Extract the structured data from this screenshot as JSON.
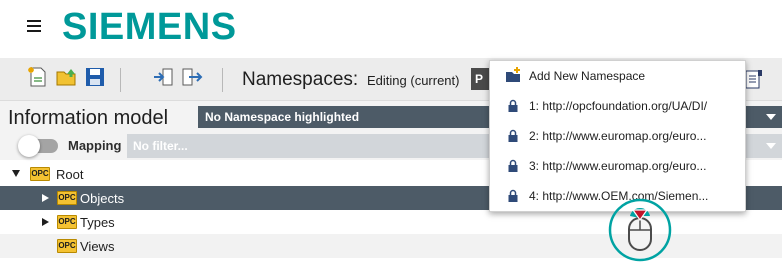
{
  "header": {
    "logo_text": "SIEMENS",
    "logo_color": "#009999"
  },
  "toolbar": {
    "namespaces_label": "Namespaces:",
    "editing_text": "Editing (current)",
    "namespace_box_text": "P",
    "icons": [
      "new-file-icon",
      "open-folder-icon",
      "save-icon",
      "import-icon",
      "export-icon",
      "properties-icon"
    ]
  },
  "info_model": {
    "title": "Information model",
    "namespace_highlight": "No Namespace highlighted"
  },
  "mapping": {
    "label": "Mapping",
    "filter_placeholder": "No filter..."
  },
  "tree": {
    "root": "Root",
    "opc_badge": "OPC",
    "items": [
      {
        "label": "Objects",
        "selected": true
      },
      {
        "label": "Types",
        "selected": false
      },
      {
        "label": "Views",
        "selected": false
      }
    ]
  },
  "menu": {
    "add_label": "Add New Namespace",
    "items": [
      {
        "label": "1: http://opcfoundation.org/UA/DI/"
      },
      {
        "label": "2: http://www.euromap.org/euro..."
      },
      {
        "label": "3: http://www.euromap.org/euro..."
      },
      {
        "label": "4: http://www.OEM.com/Siemen..."
      }
    ]
  },
  "colors": {
    "accent": "#009999",
    "selection": "#4d5b67",
    "lock": "#2f4a78",
    "pointer_ring": "#00a3a3",
    "pointer_arrow": "#c0152a"
  }
}
